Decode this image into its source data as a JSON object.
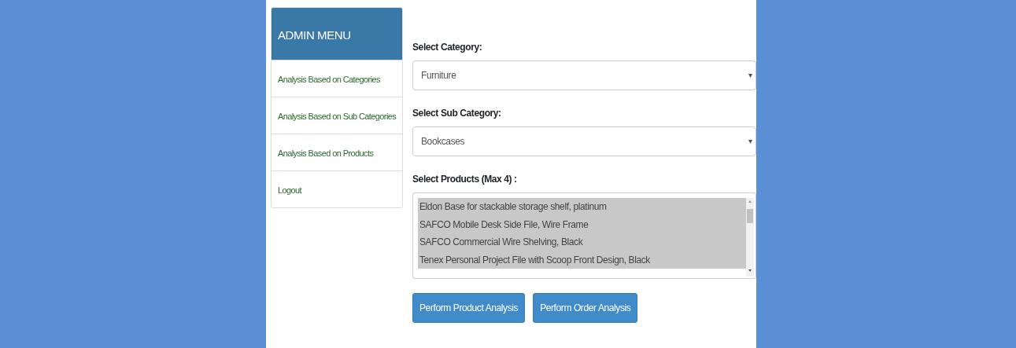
{
  "sidebar": {
    "title": "ADMIN MENU",
    "items": [
      {
        "label": "Analysis Based on Categories"
      },
      {
        "label": "Analysis Based on Sub Categories"
      },
      {
        "label": "Analysis Based on Products"
      },
      {
        "label": "Logout"
      }
    ]
  },
  "form": {
    "category": {
      "label": "Select Category:",
      "value": "Furniture"
    },
    "sub_category": {
      "label": "Select Sub Category:",
      "value": "Bookcases"
    },
    "products": {
      "label": "Select Products (Max 4) :",
      "options": [
        {
          "label": "Eldon Base for stackable storage shelf, platinum",
          "selected": true
        },
        {
          "label": "SAFCO Mobile Desk Side File, Wire Frame",
          "selected": true
        },
        {
          "label": "SAFCO Commercial Wire Shelving, Black",
          "selected": true
        },
        {
          "label": "Tenex Personal Project File with Scoop Front Design, Black",
          "selected": true
        }
      ]
    },
    "buttons": [
      "Perform Product Analysis",
      "Perform Order Analysis"
    ]
  }
}
